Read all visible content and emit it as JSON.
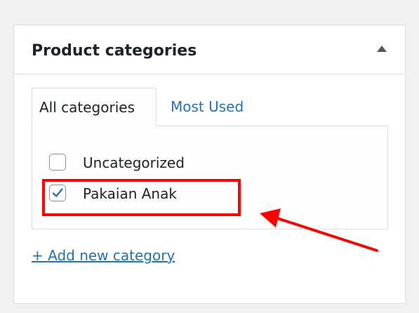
{
  "panel": {
    "title": "Product categories",
    "collapse_icon": "triangle-up-icon"
  },
  "tabs": [
    {
      "label": "All categories",
      "active": true
    },
    {
      "label": "Most Used",
      "active": false
    }
  ],
  "categories": [
    {
      "label": "Uncategorized",
      "checked": false
    },
    {
      "label": "Pakaian Anak",
      "checked": true
    }
  ],
  "add_link": "+ Add new category",
  "colors": {
    "accent": "#2271b1",
    "annotation": "#ff0000",
    "text": "#1d2327",
    "border": "#dcdcde"
  },
  "annotations": {
    "highlight": "red-rectangle",
    "pointer": "red-arrow-icon"
  }
}
